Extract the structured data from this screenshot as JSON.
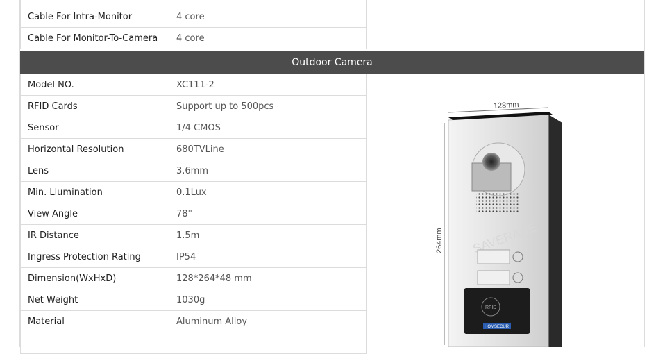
{
  "top_rows": [
    {
      "label": "",
      "value": ""
    },
    {
      "label": "Cable For Intra-Monitor",
      "value": "4 core"
    },
    {
      "label": "Cable For Monitor-To-Camera",
      "value": "4 core"
    }
  ],
  "section_title": "Outdoor Camera",
  "camera_rows": [
    {
      "label": "Model NO.",
      "value": "XC111-2"
    },
    {
      "label": "RFID Cards",
      "value": "Support up to 500pcs"
    },
    {
      "label": "Sensor",
      "value": "1/4 CMOS"
    },
    {
      "label": "Horizontal Resolution",
      "value": "680TVLine"
    },
    {
      "label": "Lens",
      "value": "3.6mm"
    },
    {
      "label": "Min. Llumination",
      "value": "0.1Lux"
    },
    {
      "label": "View Angle",
      "value": "78°"
    },
    {
      "label": "IR Distance",
      "value": "1.5m"
    },
    {
      "label": "Ingress Protection Rating",
      "value": "IP54"
    },
    {
      "label": "Dimension(WxHxD)",
      "value": "128*264*48 mm"
    },
    {
      "label": "Net Weight",
      "value": "1030g"
    },
    {
      "label": "Material",
      "value": "Aluminum Alloy"
    },
    {
      "label": "",
      "value": ""
    }
  ],
  "image": {
    "width_label": "128mm",
    "height_label": "264mm",
    "rfid_label": "RFID",
    "brand_label": "HOMSECUR",
    "watermark": "SAVERASE"
  }
}
